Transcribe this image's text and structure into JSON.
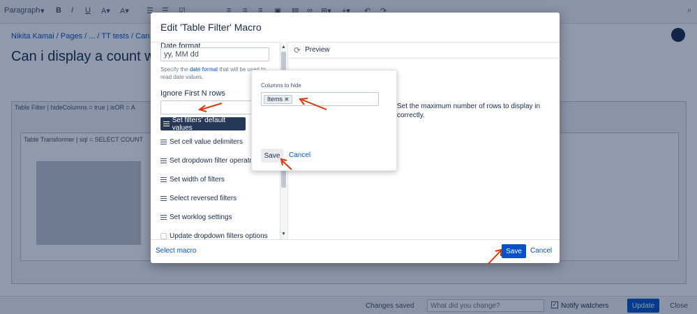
{
  "toolbar": {
    "paragraph": "Paragraph"
  },
  "breadcrumbs": {
    "user": "Nikita Kamai",
    "pages": "Pages",
    "ellipsis": "...",
    "tt": "TT tests",
    "page": "Can i disp"
  },
  "page_title": "Can i display a count wit",
  "macro_bg": {
    "table_filter": "Table Filter | hideColumns = true | isOR = A",
    "table_transformer": "Table Transformer | sql = SELECT COUNT"
  },
  "dialog": {
    "title": "Edit 'Table Filter' Macro",
    "date_format_label": "Date format",
    "date_format_value": "yy, MM dd",
    "help_prefix": "Specify the ",
    "help_link": "date format",
    "help_suffix": " that will be used to read date values.",
    "ignore_label": "Ignore First N rows",
    "ignore_value": "",
    "menu": {
      "default_values": "Set filters' default values",
      "delimiters": "Set cell value delimiters",
      "operators": "Set dropdown filter operato",
      "width": "Set width of filters",
      "reversed": "Select reversed filters",
      "worklog": "Set worklog settings",
      "update_dropdown": "Update dropdown filters options"
    },
    "preview_label": "Preview",
    "preview_text": "Set the maximum number of rows to display in correctly.",
    "select_macro": "Select macro",
    "save": "Save",
    "cancel": "Cancel"
  },
  "popup": {
    "label": "Columns to hide",
    "tag": "Items",
    "save": "Save",
    "cancel": "Cancel"
  },
  "footer": {
    "changes_saved": "Changes saved",
    "placeholder": "What did you change?",
    "notify": "Notify watchers",
    "update": "Update",
    "close": "Close"
  }
}
